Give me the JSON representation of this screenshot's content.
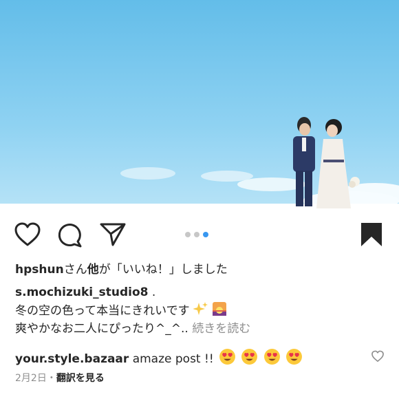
{
  "photo": {
    "alt": "wedding couple under blue sky"
  },
  "actions": {
    "like_icon": "heart-outline-icon",
    "comment_icon": "comment-bubble-icon",
    "share_icon": "paper-plane-icon",
    "save_icon": "bookmark-filled-icon"
  },
  "carousel": {
    "count": 3,
    "active_index": 2,
    "active_color": "#3897f0",
    "inactive_color": "#c7c7c7"
  },
  "likes": {
    "user": "hpshun",
    "text_mid": "さん",
    "bold_other": "他",
    "text_end": "が「いいね！」しました"
  },
  "caption": {
    "user": "s.mochizuki_studio8",
    "after_user": " .",
    "line1": "冬の空の色って本当にきれいです",
    "line1_emojis": [
      "sparkles",
      "sunrise"
    ],
    "line2": "爽やかなお二人にぴったり^_^..",
    "more": "続きを読む"
  },
  "comment": {
    "user": "your.style.bazaar",
    "text": "amaze post !!",
    "emojis": [
      "heart-eyes",
      "heart-eyes",
      "heart-eyes",
      "heart-eyes"
    ]
  },
  "meta": {
    "date": "2月2日",
    "separator": "・",
    "translate": "翻訳を見る"
  }
}
